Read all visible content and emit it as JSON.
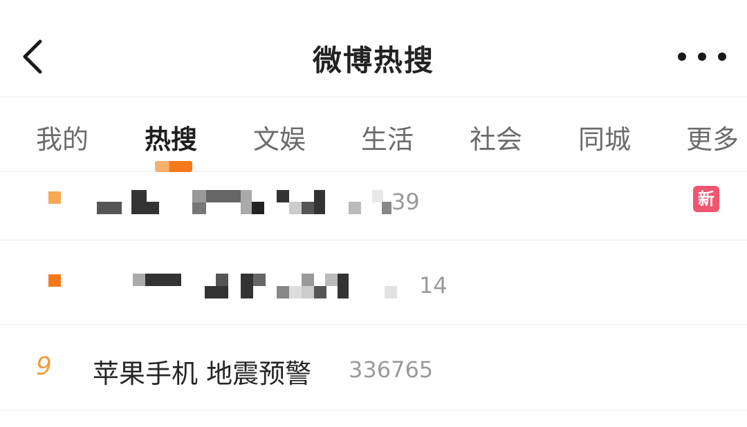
{
  "header": {
    "back_icon": "back-arrow-icon",
    "title": "微博热搜",
    "more_icon": "more-dots-icon"
  },
  "tabs": [
    {
      "label": "我的",
      "active": false
    },
    {
      "label": "热搜",
      "active": true
    },
    {
      "label": "文娱",
      "active": false
    },
    {
      "label": "生活",
      "active": false
    },
    {
      "label": "社会",
      "active": false
    },
    {
      "label": "同城",
      "active": false
    },
    {
      "label": "更多",
      "active": false
    }
  ],
  "list": [
    {
      "rank_marker": "square",
      "rank_color": "#f7a955",
      "topic": "",
      "count_partial": "39",
      "badge": "新",
      "badge_color": "#f0566f",
      "obscured": true
    },
    {
      "rank_marker": "square",
      "rank_color": "#f5791a",
      "topic": "",
      "count_partial": "14",
      "badge": "",
      "obscured": true
    },
    {
      "rank": "9",
      "topic": "苹果手机 地震预警",
      "count": "336765",
      "badge": ""
    }
  ],
  "colors": {
    "accent_orange": "#f5791a",
    "accent_orange_light": "#f7b06d",
    "rank_text": "#f29b3c",
    "badge_new": "#f0566f"
  }
}
